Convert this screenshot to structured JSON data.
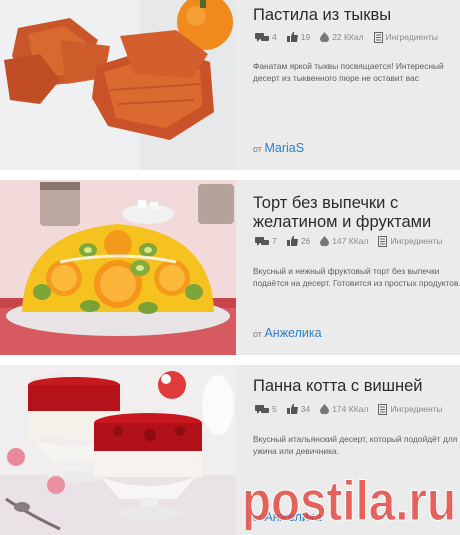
{
  "recipes": [
    {
      "title": "Пастила из тыквы",
      "comments": "4",
      "likes": "19",
      "calories": "22 ККал",
      "ingredients_label": "Ингредиенты",
      "description": "Фанатам яркой тыквы посвящается! Интересный десерт из тыквенного пюре не оставит вас равнодушными.",
      "author_prefix": "от",
      "author": "MariaS"
    },
    {
      "title": "Торт без выпечки с желатином и фруктами",
      "comments": "7",
      "likes": "26",
      "calories": "147 ККал",
      "ingredients_label": "Ингредиенты",
      "description_line1": "Вкусный и нежный фруктовый торт без выпечки",
      "description_line2": "подаётся на десерт. Готовится из простых продуктов.",
      "author_prefix": "от",
      "author": "Анжелика"
    },
    {
      "title": "Панна котта с вишней",
      "comments": "5",
      "likes": "34",
      "calories": "174 ККал",
      "ingredients_label": "Ингредиенты",
      "description_line1": "Вкусный итальянский десерт, который подойдёт для",
      "description_line2": "ужина или девичника.",
      "author_prefix": "от",
      "author": "Анжелика"
    }
  ],
  "watermark": "postila.ru",
  "colors": {
    "link": "#2f80c9",
    "card_bg": "#ebebeb",
    "watermark": "#e23a33"
  }
}
